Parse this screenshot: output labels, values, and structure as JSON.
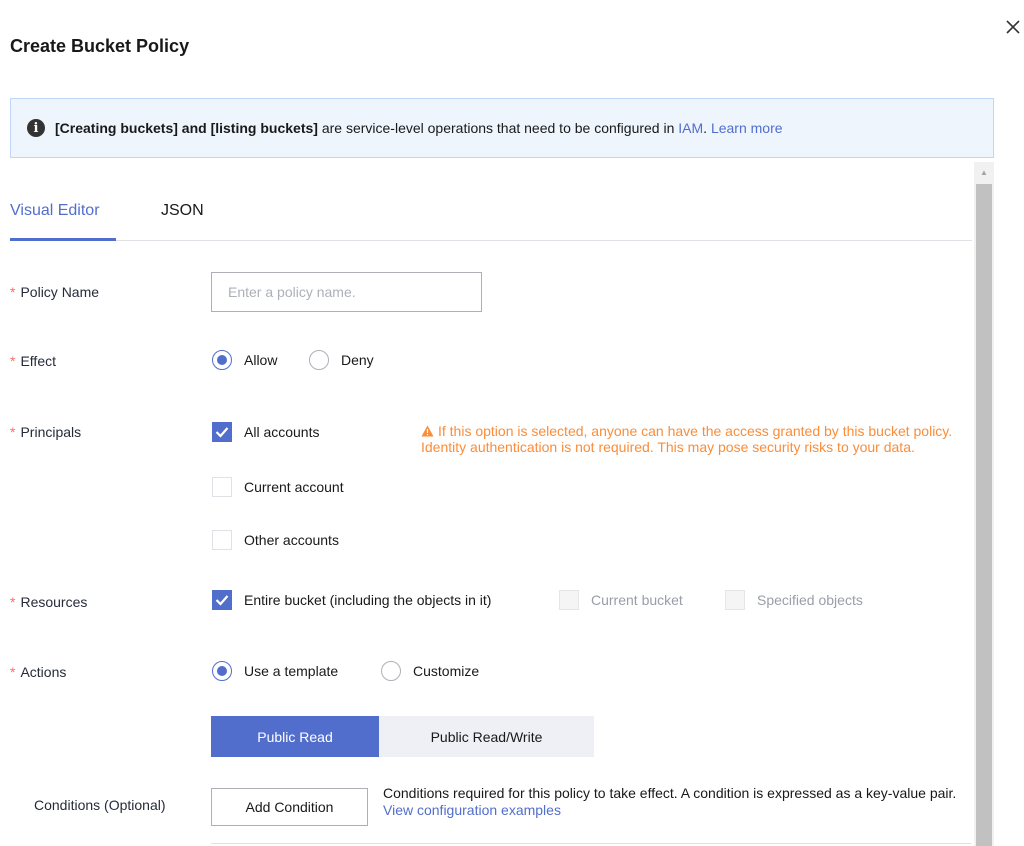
{
  "dialog": {
    "title": "Create Bucket Policy",
    "close_glyph": "×"
  },
  "info": {
    "icon": "info-icon",
    "glyph": "i",
    "bold_text": "[Creating buckets] and [listing buckets]",
    "text": " are service-level operations that need to be configured in ",
    "iam_link": "IAM",
    "period": ".",
    "learn_more": "Learn more"
  },
  "tabs": {
    "visual_editor": "Visual Editor",
    "json": "JSON",
    "active": "Visual Editor"
  },
  "form": {
    "required_mark": "*",
    "policy_name": {
      "label": "Policy Name",
      "placeholder": "Enter a policy name.",
      "value": ""
    },
    "effect": {
      "label": "Effect",
      "allow": "Allow",
      "deny": "Deny",
      "selected": "Allow"
    },
    "principals": {
      "label": "Principals",
      "all_accounts": "All accounts",
      "current_account": "Current account",
      "other_accounts": "Other accounts",
      "checked": [
        "All accounts"
      ],
      "warning": "If this option is selected, anyone can have the access granted by this bucket policy. Identity authentication is not required. This may pose security risks to your data."
    },
    "resources": {
      "label": "Resources",
      "entire_bucket": "Entire bucket (including the objects in it)",
      "current_bucket": "Current bucket",
      "specified_objects": "Specified objects",
      "checked": [
        "Entire bucket (including the objects in it)"
      ]
    },
    "actions": {
      "label": "Actions",
      "use_template": "Use a template",
      "customize": "Customize",
      "selected": "Use a template",
      "templates": [
        "Public Read",
        "Public Read/Write"
      ],
      "active_template": "Public Read"
    },
    "conditions": {
      "label": "Conditions (Optional)",
      "add_button": "Add Condition",
      "description": "Conditions required for this policy to take effect. A condition is expressed as a key-value pair.",
      "examples_link": "View configuration examples"
    }
  },
  "colors": {
    "brand": "#526ecc",
    "required": "#f66f6a",
    "warning": "#fa8d3a",
    "info_bg": "#eef5fd"
  }
}
